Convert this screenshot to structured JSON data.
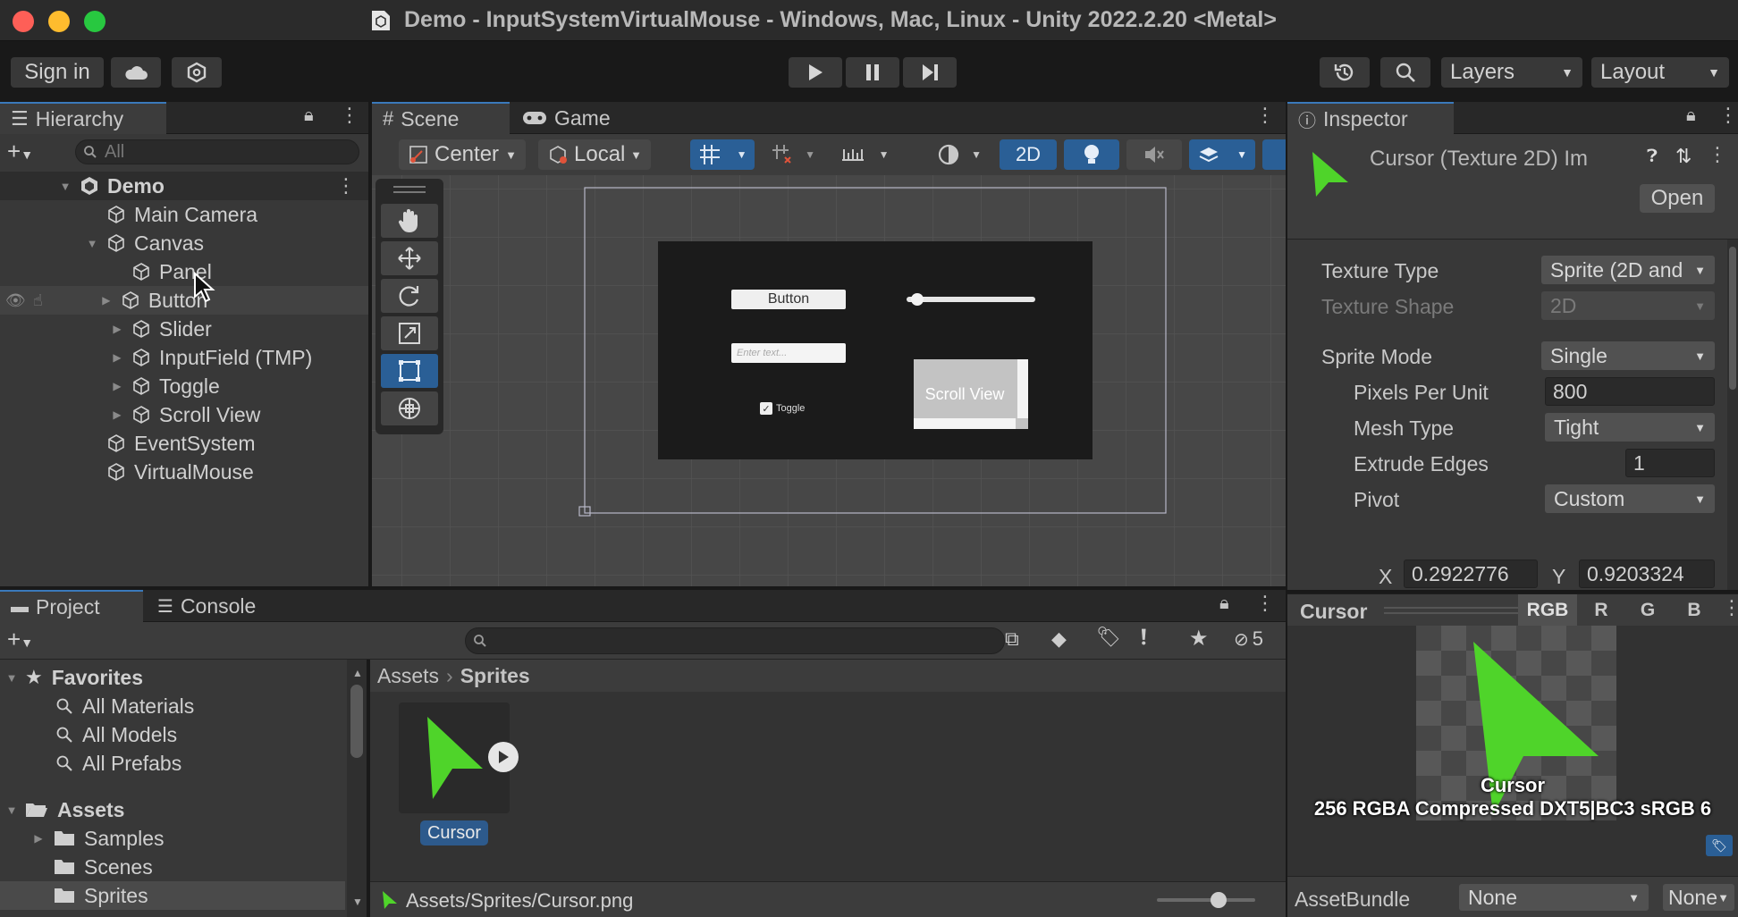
{
  "window": {
    "title": "Demo - InputSystemVirtualMouse - Windows, Mac, Linux - Unity 2022.2.20 <Metal>"
  },
  "toolbar": {
    "sign_in": "Sign in",
    "layers": "Layers",
    "layout": "Layout"
  },
  "hierarchy": {
    "tab": "Hierarchy",
    "search_placeholder": "All",
    "root": "Demo",
    "items": [
      {
        "label": "Main Camera"
      },
      {
        "label": "Canvas"
      },
      {
        "label": "Panel"
      },
      {
        "label": "Button"
      },
      {
        "label": "Slider"
      },
      {
        "label": "InputField (TMP)"
      },
      {
        "label": "Toggle"
      },
      {
        "label": "Scroll View"
      },
      {
        "label": "EventSystem"
      },
      {
        "label": "VirtualMouse"
      }
    ]
  },
  "scene": {
    "tab_scene": "Scene",
    "tab_game": "Game",
    "pivot": "Center",
    "space": "Local",
    "mode_2d": "2D",
    "ui_button": "Button",
    "ui_input_placeholder": "Enter text...",
    "ui_toggle": "Toggle",
    "ui_scroll": "Scroll View",
    "slider_value": 0.04
  },
  "inspector": {
    "tab": "Inspector",
    "asset_title": "Cursor (Texture 2D) Im",
    "open_button": "Open",
    "fields": {
      "texture_type_label": "Texture Type",
      "texture_type_value": "Sprite (2D and",
      "texture_shape_label": "Texture Shape",
      "texture_shape_value": "2D",
      "sprite_mode_label": "Sprite Mode",
      "sprite_mode_value": "Single",
      "ppu_label": "Pixels Per Unit",
      "ppu_value": "800",
      "mesh_type_label": "Mesh Type",
      "mesh_type_value": "Tight",
      "extrude_label": "Extrude Edges",
      "extrude_value": "1",
      "pivot_label": "Pivot",
      "pivot_value": "Custom",
      "x_label": "X",
      "x_value": "0.2922776",
      "y_label": "Y",
      "y_value": "0.9203324"
    },
    "preview": {
      "title": "Cursor",
      "channels": [
        "RGB",
        "R",
        "G",
        "B"
      ],
      "image_label": "Cursor",
      "info": "256  RGBA Compressed DXT5|BC3 sRGB  6"
    },
    "assetbundle_label": "AssetBundle",
    "assetbundle_value": "None",
    "assetbundle_variant": "None"
  },
  "project": {
    "tab_project": "Project",
    "tab_console": "Console",
    "hidden_count": "5",
    "favorites": "Favorites",
    "fav_items": [
      "All Materials",
      "All Models",
      "All Prefabs"
    ],
    "assets": "Assets",
    "asset_folders": [
      "Samples",
      "Scenes",
      "Sprites"
    ],
    "breadcrumb_root": "Assets",
    "breadcrumb_current": "Sprites",
    "asset_name": "Cursor",
    "path": "Assets/Sprites/Cursor.png"
  },
  "colors": {
    "accent": "#3a79bb",
    "cursor_green": "#4fd42a",
    "panel": "#383838"
  }
}
